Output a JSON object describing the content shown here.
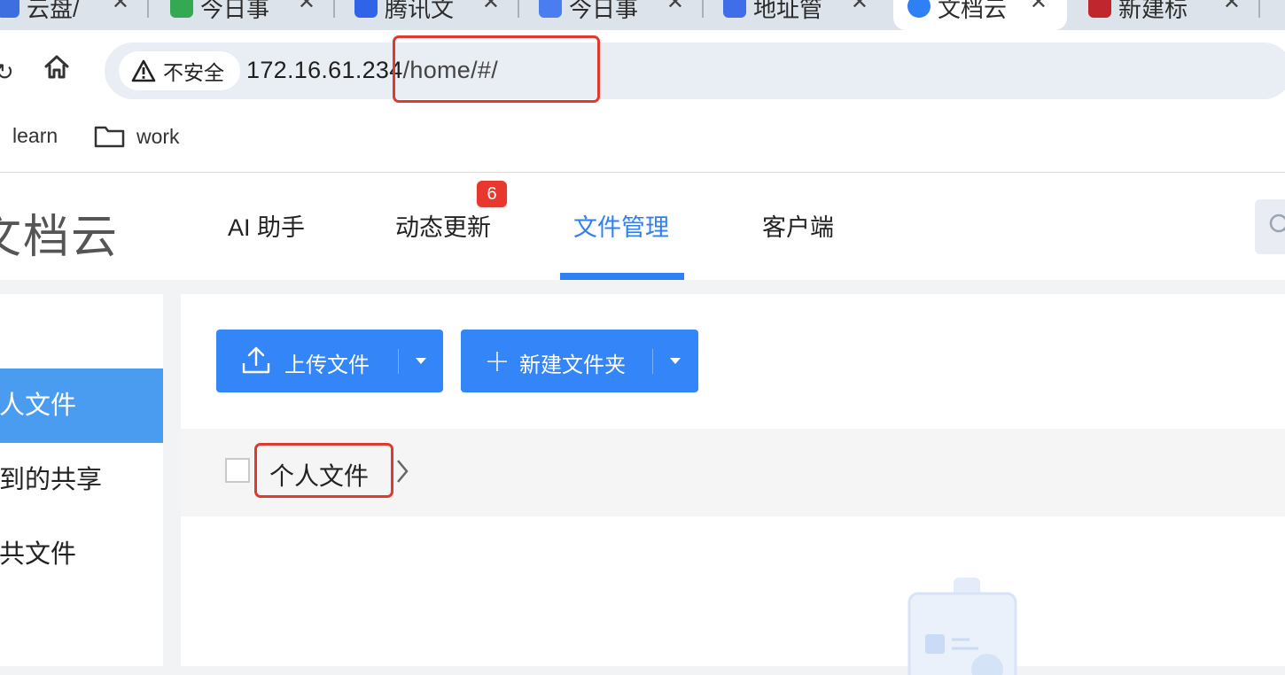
{
  "browser": {
    "tabs": [
      {
        "title": "云盘/",
        "favicon_color": "#3d6fe0"
      },
      {
        "title": "今日事",
        "favicon_color": "#34a853"
      },
      {
        "title": "腾讯文",
        "favicon_color": "#2f63e8"
      },
      {
        "title": "今日事",
        "favicon_color": "#4a7df0"
      },
      {
        "title": "地址管",
        "favicon_color": "#3f6ee8"
      },
      {
        "title": "文档云",
        "favicon_color": "#2f80f5",
        "active": true
      },
      {
        "title": "新建标",
        "favicon_color": "#c0262d"
      }
    ],
    "security_label": "不安全",
    "url_host": "172.16.61.234",
    "url_path": "/home/#/",
    "bookmarks": [
      {
        "label": "learn",
        "icon": "none"
      },
      {
        "label": "work",
        "icon": "folder-icon"
      }
    ]
  },
  "app": {
    "logo": "文档云",
    "nav": [
      {
        "label": "AI 助手"
      },
      {
        "label": "动态更新",
        "badge": "6"
      },
      {
        "label": "文件管理",
        "active": true
      },
      {
        "label": "客户端"
      }
    ],
    "accent_color": "#2f7ff5",
    "badge_color": "#e8372c"
  },
  "sidebar": {
    "items": [
      {
        "label": "个人文件",
        "active": true
      },
      {
        "label": "收到的共享"
      },
      {
        "label": "公共文件"
      }
    ]
  },
  "toolbar": {
    "upload_label": "上传文件",
    "new_folder_label": "新建文件夹"
  },
  "breadcrumb": {
    "current": "个人文件"
  },
  "annotation": {
    "highlight_color": "#e03a2e"
  }
}
